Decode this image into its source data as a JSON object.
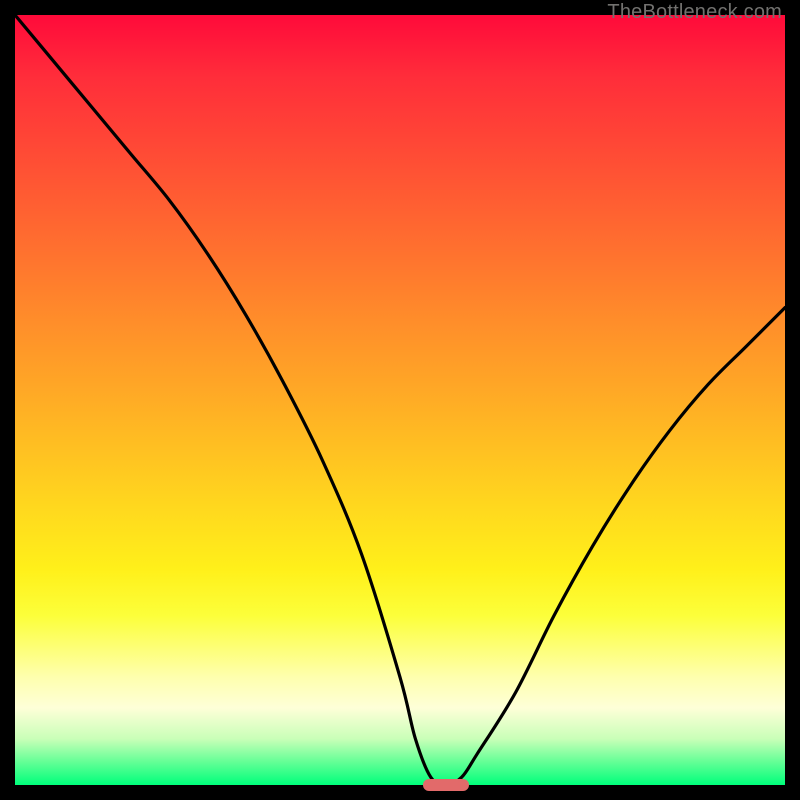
{
  "watermark": {
    "text": "TheBottleneck.com"
  },
  "colors": {
    "frame": "#000000",
    "marker": "#e26a6a",
    "curve": "#000000"
  },
  "plot": {
    "inner_left": 15,
    "inner_top": 15,
    "inner_width": 770,
    "inner_height": 770
  },
  "chart_data": {
    "type": "line",
    "title": "",
    "xlabel": "",
    "ylabel": "",
    "xlim": [
      0,
      100
    ],
    "ylim": [
      0,
      100
    ],
    "grid": false,
    "legend": false,
    "series": [
      {
        "name": "bottleneck-curve",
        "x": [
          0,
          5,
          10,
          15,
          20,
          25,
          30,
          35,
          40,
          45,
          50,
          52,
          54,
          56,
          58,
          60,
          65,
          70,
          75,
          80,
          85,
          90,
          95,
          100
        ],
        "values": [
          100,
          94,
          88,
          82,
          76,
          69,
          61,
          52,
          42,
          30,
          14,
          6,
          1,
          0,
          1,
          4,
          12,
          22,
          31,
          39,
          46,
          52,
          57,
          62
        ]
      }
    ],
    "annotations": [
      {
        "type": "marker",
        "shape": "pill",
        "x_start": 53,
        "x_end": 59,
        "y": 0,
        "color": "#e26a6a"
      }
    ],
    "gradient_stops": [
      {
        "pct": 0,
        "color": "#ff0a3a"
      },
      {
        "pct": 50,
        "color": "#ffd000"
      },
      {
        "pct": 85,
        "color": "#feffae"
      },
      {
        "pct": 100,
        "color": "#00ff7b"
      }
    ]
  }
}
